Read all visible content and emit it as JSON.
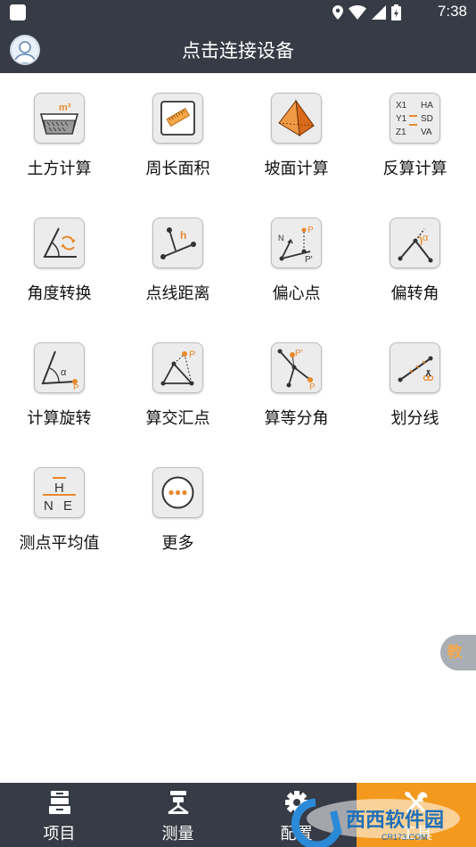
{
  "status_bar": {
    "time": "7:38"
  },
  "app_bar": {
    "title": "点击连接设备"
  },
  "grid": {
    "items": [
      {
        "label": "土方计算",
        "icon": "earthwork-icon"
      },
      {
        "label": "周长面积",
        "icon": "perimeter-area-icon"
      },
      {
        "label": "坡面计算",
        "icon": "slope-icon"
      },
      {
        "label": "反算计算",
        "icon": "inverse-calc-icon"
      },
      {
        "label": "角度转换",
        "icon": "angle-convert-icon"
      },
      {
        "label": "点线距离",
        "icon": "point-line-distance-icon"
      },
      {
        "label": "偏心点",
        "icon": "eccentric-point-icon"
      },
      {
        "label": "偏转角",
        "icon": "deflection-angle-icon"
      },
      {
        "label": "计算旋转",
        "icon": "rotation-calc-icon"
      },
      {
        "label": "算交汇点",
        "icon": "intersection-point-icon"
      },
      {
        "label": "算等分角",
        "icon": "angle-bisect-icon"
      },
      {
        "label": "划分线",
        "icon": "divide-line-icon"
      },
      {
        "label": "测点平均值",
        "icon": "point-average-icon"
      },
      {
        "label": "更多",
        "icon": "more-icon"
      }
    ]
  },
  "tile_text": {
    "m3": "m³",
    "x1": "X1",
    "y1": "Y1",
    "z1": "Z1",
    "ha": "HA",
    "sd": "SD",
    "va": "VA",
    "h": "h",
    "p": "P",
    "n": "N",
    "pprime": "P′",
    "alpha": "α",
    "hbar": "H",
    "n2": "N",
    "e": "E"
  },
  "side_tab": {
    "label": "教"
  },
  "bottom_nav": {
    "tabs": [
      {
        "label": "项目",
        "icon": "project-icon"
      },
      {
        "label": "测量",
        "icon": "survey-instrument-icon"
      },
      {
        "label": "配置",
        "icon": "gear-icon"
      },
      {
        "label": "工具",
        "icon": "tools-icon"
      }
    ]
  },
  "watermark": {
    "text": "西西软件园",
    "sub": "CR173.COM"
  },
  "colors": {
    "bar": "#363b45",
    "accent": "#f39a1e"
  }
}
